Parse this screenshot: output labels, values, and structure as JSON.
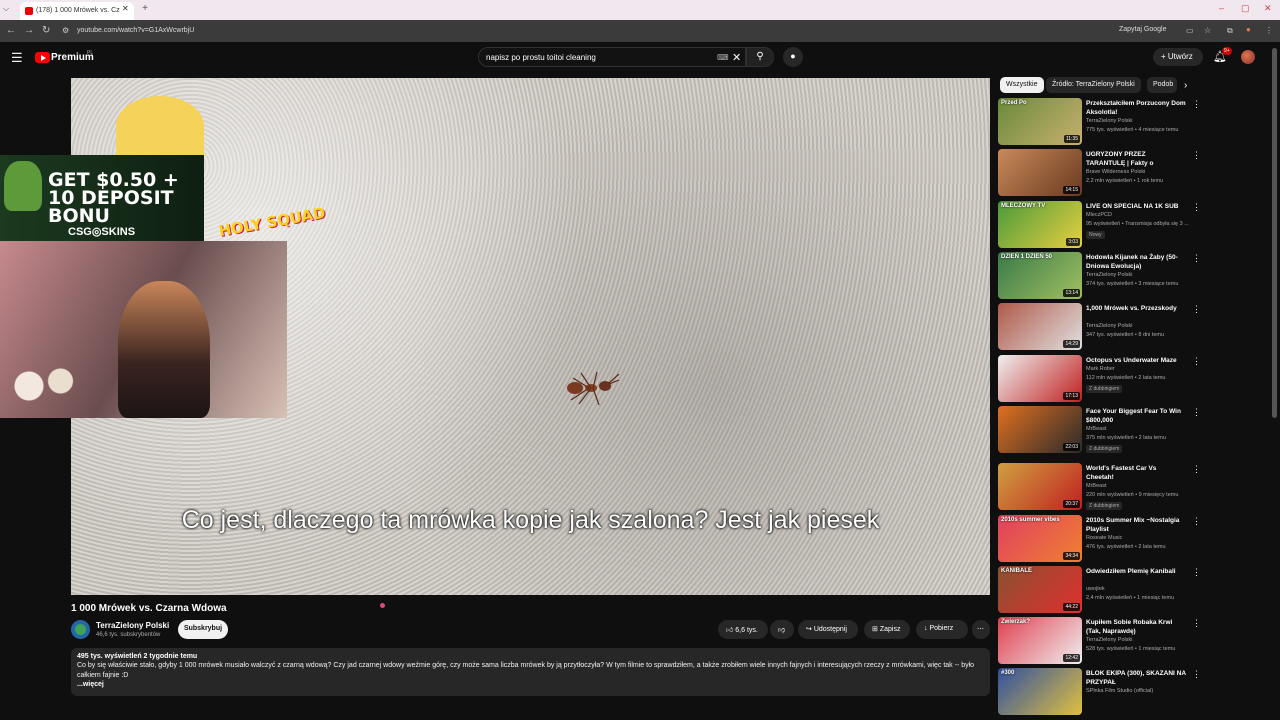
{
  "browser": {
    "tab_title": "(178) 1 000 Mrówek vs. Cz",
    "url": "youtube.com/watch?v=G1AxWcwrbjU",
    "zapytaj_label": "Zapytaj Google"
  },
  "masthead": {
    "logo_text": "Premium",
    "logo_region": "PL",
    "search_value": "napisz po prostu toitoi cleaning",
    "create_label": "Utwórz",
    "notif_count": "9+"
  },
  "player": {
    "subtitle": "Co jest, dlaczego ta mrówka kopie jak szalona? Jest jak piesek",
    "overlay_ad_text": "GET $0.50 + 10 DEPOSIT BONU",
    "overlay_ad_brand": "CSG◎SKINS",
    "overlay_sticker": "HOLY SQUAD"
  },
  "video": {
    "title": "1 000 Mrówek vs. Czarna Wdowa",
    "channel_name": "TerraZielony Polski",
    "channel_subs": "46,6 tys. subskrybentów",
    "subscribe_label": "Subskrybuj",
    "like_count": "6,6 tys.",
    "share_label": "Udostępnij",
    "save_label": "Zapisz",
    "download_label": "Pobierz",
    "desc_meta": "495 tys. wyświetleń  2 tygodnie temu",
    "desc_text": "Co by się właściwie stało, gdyby 1 000 mrówek musiało walczyć z czarną wdową? Czy jad czarnej wdowy weźmie górę, czy może sama liczba mrówek by ją przytłoczyła? W tym filmie to sprawdziłem, a także zrobiłem wiele innych fajnych i interesujących rzeczy z mrówkami, więc tak -- było całkiem fajnie :D",
    "desc_more": "...więcej"
  },
  "chips": [
    "Wszystkie",
    "Źródło: TerraZielony Polski",
    "Podob"
  ],
  "recommendations": [
    {
      "title": "Przekształciłem Porzucony Dom Aksolotla!",
      "channel": "TerraZielony Polski",
      "meta": "775 tys. wyświetleń • 4 miesiące temu",
      "duration": "11:35",
      "badge": "",
      "thumb_color": "#6a8a3a",
      "thumb_color2": "#c8b070",
      "thumb_label": "Przed   Po"
    },
    {
      "title": "UGRYZONY PRZEZ TARANTULĘ | Fakty o zwierzętach | Brave ...",
      "channel": "Brave Wilderness Polski",
      "meta": "2,2 mln wyświetleń • 1 rok temu",
      "duration": "14:15",
      "badge": "",
      "thumb_color": "#c98a5a",
      "thumb_color2": "#6a3a20",
      "thumb_label": ""
    },
    {
      "title": "LIVE ON SPECIAL NA 1K SUB",
      "channel": "MleczPCD",
      "meta": "95 wyświetleń • Transmisja odbyła się 3 ...",
      "duration": "3:03",
      "badge": "Nowy",
      "thumb_color": "#4a9a3a",
      "thumb_color2": "#e8d040",
      "thumb_label": "MLECZOWY TV"
    },
    {
      "title": "Hodowla Kijanek na Żaby (50-Dniowa Ewolucja)",
      "channel": "TerraZielony Polski",
      "meta": "374 tys. wyświetleń • 3 miesiące temu",
      "duration": "13:14",
      "badge": "",
      "thumb_color": "#3a7a4a",
      "thumb_color2": "#a0c060",
      "thumb_label": "DZIEŃ 1  DZIEŃ 50"
    },
    {
      "title": "1,000 Mrówek vs. Przezskody",
      "channel": "TerraZielony Polski",
      "meta": "347 tys. wyświetleń • 8 dni temu",
      "duration": "14:29",
      "badge": "",
      "thumb_color": "#b05a4a",
      "thumb_color2": "#e0e0e0",
      "thumb_label": ""
    },
    {
      "title": "Octopus vs Underwater Maze",
      "channel": "Mark Rober",
      "meta": "112 mln wyświetleń • 2 lata temu",
      "duration": "17:13",
      "badge": "Z dubbingiem",
      "thumb_color": "#f0f0f0",
      "thumb_color2": "#c02020",
      "thumb_label": ""
    },
    {
      "title": "Face Your Biggest Fear To Win $800,000",
      "channel": "MrBeast",
      "meta": "375 mln wyświetleń • 2 lata temu",
      "duration": "22:03",
      "badge": "Z dubbingiem",
      "thumb_color": "#e07020",
      "thumb_color2": "#2a2a2a",
      "thumb_label": ""
    },
    {
      "title": "World's Fastest Car Vs Cheetah!",
      "channel": "MrBeast",
      "meta": "220 mln wyświetleń • 9 miesięcy temu",
      "duration": "20:37",
      "badge": "Z dubbingiem",
      "thumb_color": "#d0a040",
      "thumb_color2": "#c02020",
      "thumb_label": ""
    },
    {
      "title": "2010s Summer Mix ~Nostalgia Playlist",
      "channel": "Roseate Music",
      "meta": "476 tys. wyświetleń • 2 lata temu",
      "duration": "34:34",
      "badge": "",
      "thumb_color": "#e04060",
      "thumb_color2": "#f08030",
      "thumb_label": "2010s summer vibes"
    },
    {
      "title": "Odwiedziłem Plemię Kanibali",
      "channel": "uwojtek",
      "meta": "2,4 mln wyświetleń • 1 miesiąc temu",
      "duration": "44:22",
      "badge": "",
      "thumb_color": "#8a5030",
      "thumb_color2": "#e03030",
      "thumb_label": "KANIBALE"
    },
    {
      "title": "Kupiłem Sobie Robaka Krwi (Tak, Naprawdę)",
      "channel": "TerraZielony Polski",
      "meta": "528 tys. wyświetleń • 1 miesiąc temu",
      "duration": "12:42",
      "badge": "",
      "thumb_color": "#e04050",
      "thumb_color2": "#f0f0f0",
      "thumb_label": "Zwierzak?"
    },
    {
      "title": "BLOK EKIPA (300), SKAZANI NA PRZYPAŁ",
      "channel": "SPlnka Film Studio (official)",
      "meta": "",
      "duration": "",
      "badge": "",
      "thumb_color": "#3050a0",
      "thumb_color2": "#e0c040",
      "thumb_label": "#300"
    }
  ]
}
